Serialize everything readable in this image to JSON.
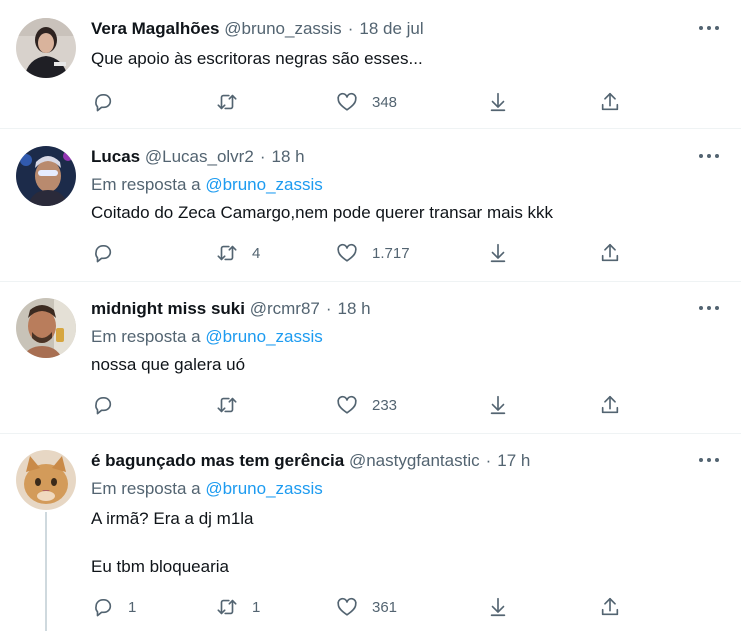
{
  "tweets": [
    {
      "name": "Vera Magalhões",
      "handle": "@bruno_zassis",
      "time": "18 de jul",
      "reply_prefix": "",
      "reply_to": "",
      "lines": [
        "Que apoio às escritoras negras são esses..."
      ],
      "replies": "",
      "retweets": "",
      "likes": "348"
    },
    {
      "name": "Lucas",
      "handle": "@Lucas_olvr2",
      "time": "18 h",
      "reply_prefix": "Em resposta a",
      "reply_to": "@bruno_zassis",
      "lines": [
        "Coitado do Zeca Camargo,nem pode querer transar mais kkk"
      ],
      "replies": "",
      "retweets": "4",
      "likes": "1.717"
    },
    {
      "name": "midnight miss suki",
      "handle": "@rcmr87",
      "time": "18 h",
      "reply_prefix": "Em resposta a",
      "reply_to": "@bruno_zassis",
      "lines": [
        "nossa que galera uó"
      ],
      "replies": "",
      "retweets": "",
      "likes": "233"
    },
    {
      "name": "é bagunçado mas tem gerência",
      "handle": "@nastygfantastic",
      "time": "17 h",
      "reply_prefix": "Em resposta a",
      "reply_to": "@bruno_zassis",
      "lines": [
        "A irmã? Era a dj m1la",
        "Eu tbm bloquearia"
      ],
      "replies": "1",
      "retweets": "1",
      "likes": "361"
    }
  ],
  "colors": {
    "text": "#0f1419",
    "secondary": "#536471",
    "link": "#1d9bf0",
    "divider": "#eff3f4"
  },
  "icons": [
    "reply-icon",
    "retweet-icon",
    "like-icon",
    "download-icon",
    "share-icon",
    "more-icon"
  ]
}
